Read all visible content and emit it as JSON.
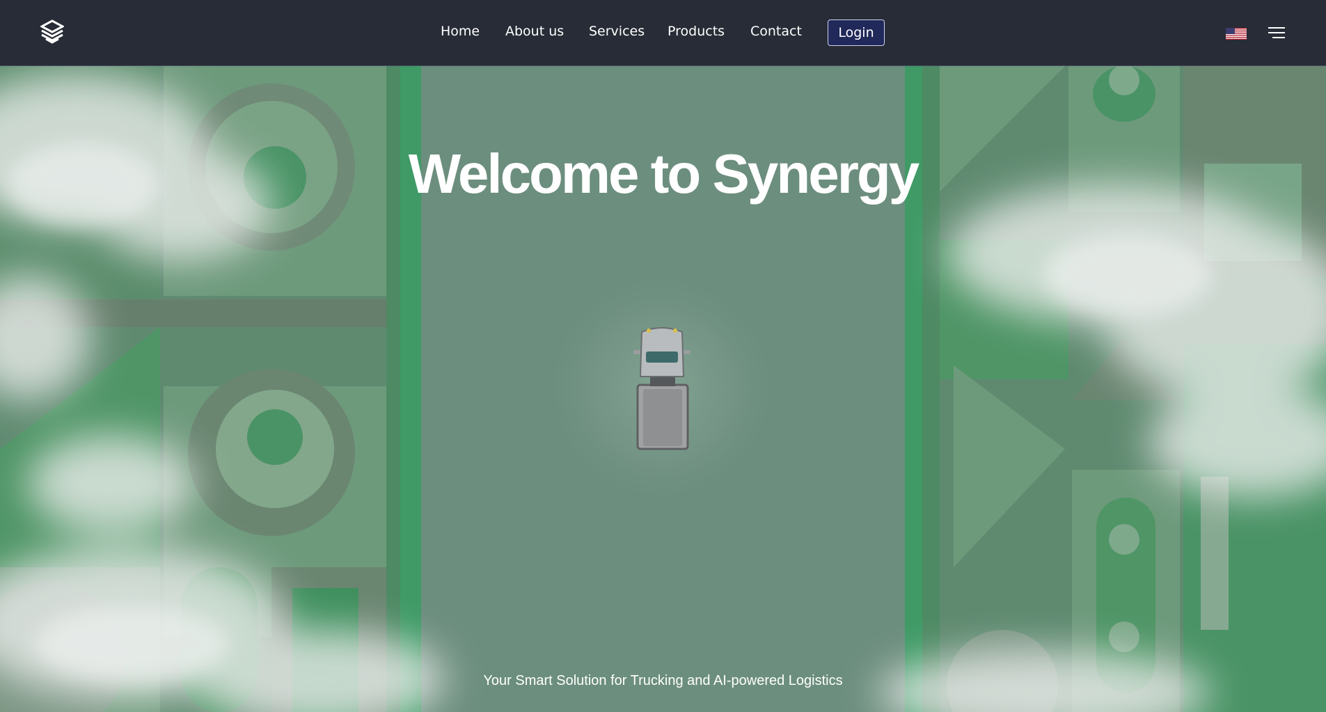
{
  "header": {
    "logo_icon": "synergy-s-logo-icon",
    "nav": [
      {
        "label": "Home"
      },
      {
        "label": "About us"
      },
      {
        "label": "Services"
      },
      {
        "label": "Products"
      },
      {
        "label": "Contact"
      }
    ],
    "login_label": "Login",
    "language_icon": "us-flag-icon",
    "menu_icon": "hamburger-menu-icon"
  },
  "hero": {
    "title_prefix": "Welcome to ",
    "title_brand": "Synergy",
    "subtitle": "Your Smart Solution for Trucking and AI-powered Logistics",
    "truck_icon": "truck-icon"
  },
  "colors": {
    "header_bg": "#272c36",
    "login_bg": "#21285a",
    "hero_green": "#6e9080",
    "accent_green": "#3f9a66"
  }
}
